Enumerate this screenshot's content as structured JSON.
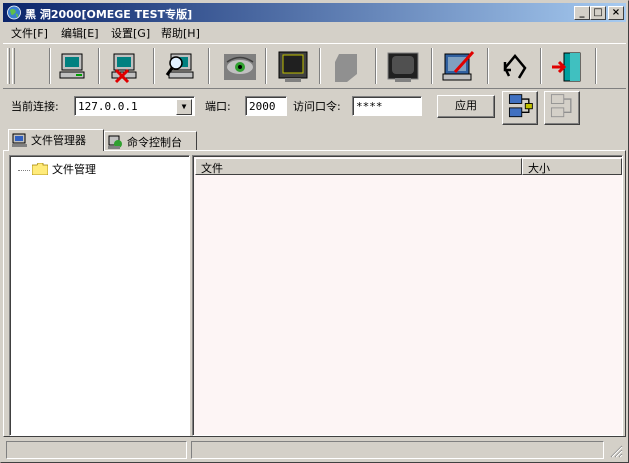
{
  "window": {
    "title": "黑 洞2000[OMEGE TEST专版]",
    "controls": {
      "minimize": "_",
      "maximize": "□",
      "close": "×"
    }
  },
  "menu": [
    {
      "label": "文件[F]"
    },
    {
      "label": "编辑[E]"
    },
    {
      "label": "设置[G]"
    },
    {
      "label": "帮助[H]"
    }
  ],
  "toolbar": {
    "icons": [
      "connect-host-icon",
      "disconnect-host-icon",
      "search-host-icon",
      "watch-eye-icon",
      "screen-monitor-icon",
      "disabled-icon",
      "tv-screen-icon",
      "edit-notebook-icon",
      "refresh-arrow-icon",
      "exit-door-icon"
    ]
  },
  "connection": {
    "current_label": "当前连接:",
    "current_value": "127.0.0.1",
    "port_label": "端口:",
    "port_value": "2000",
    "password_label": "访问口令:",
    "password_value": "****",
    "apply_label": "应用"
  },
  "tabs": [
    {
      "label": "文件管理器",
      "icon": "file-manager-icon",
      "active": true
    },
    {
      "label": "命令控制台",
      "icon": "console-icon",
      "active": false
    }
  ],
  "tree": {
    "root_label": "文件管理"
  },
  "file_list": {
    "columns": [
      "文件",
      "大小"
    ]
  },
  "colors": {
    "titlebar_start": "#0a246a",
    "titlebar_end": "#a6caf0",
    "face": "#d4d0c8",
    "list_bg": "#fdf5f5"
  }
}
